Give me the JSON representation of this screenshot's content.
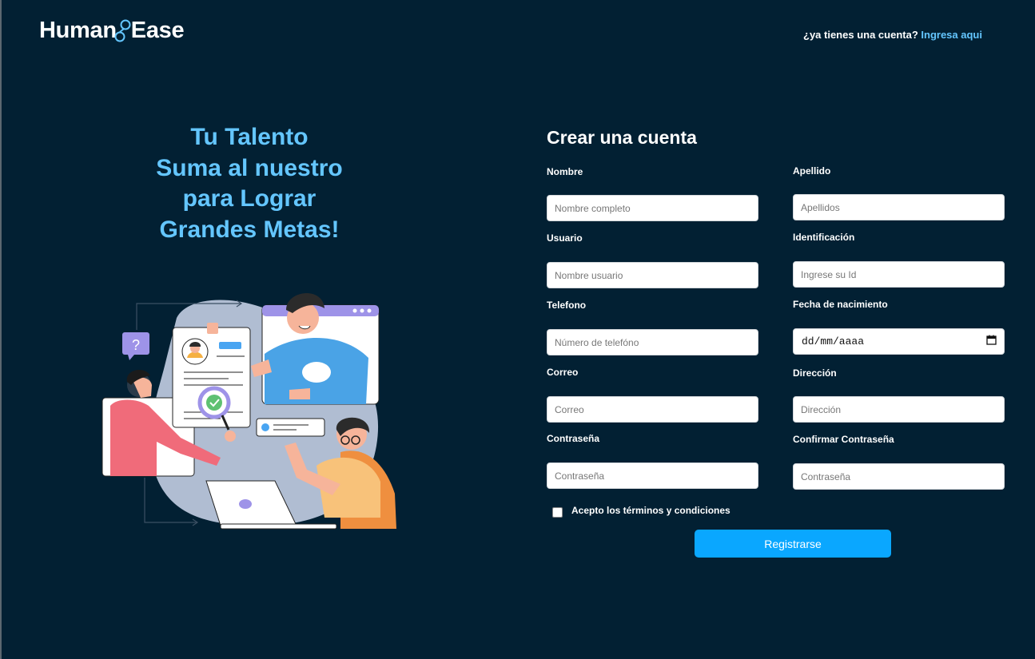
{
  "brand": {
    "name_left": "Human",
    "name_right": "Ease"
  },
  "header": {
    "prompt": "¿ya tienes una cuenta?",
    "login_link": "Ingresa aqui"
  },
  "hero": {
    "lines": [
      "Tu Talento",
      "Suma al nuestro",
      "para Lograr",
      "Grandes Metas!"
    ]
  },
  "form": {
    "title": "Crear una cuenta",
    "fields": {
      "nombre": {
        "label": "Nombre",
        "placeholder": "Nombre completo"
      },
      "apellido": {
        "label": "Apellido",
        "placeholder": "Apellidos"
      },
      "usuario": {
        "label": "Usuario",
        "placeholder": "Nombre usuario"
      },
      "identificacion": {
        "label": "Identificación",
        "placeholder": "Ingrese su Id"
      },
      "telefono": {
        "label": "Telefono",
        "placeholder": "Número de telefóno"
      },
      "fecha": {
        "label": "Fecha de nacimiento",
        "placeholder": "dd/mm/aaaa"
      },
      "correo": {
        "label": "Correo",
        "placeholder": "Correo"
      },
      "direccion": {
        "label": "Dirección",
        "placeholder": "Dirección"
      },
      "contrasena": {
        "label": "Contraseña",
        "placeholder": "Contraseña"
      },
      "confirmar": {
        "label": "Confirmar Contraseña",
        "placeholder": "Contraseña"
      }
    },
    "terms_label": "Acepto los términos y condiciones",
    "terms_checked": false,
    "submit_label": "Registrarse"
  },
  "illustration": {
    "question_mark": "?"
  },
  "colors": {
    "background": "#022033",
    "accent": "#64c6ff",
    "button": "#0aa7ff"
  }
}
